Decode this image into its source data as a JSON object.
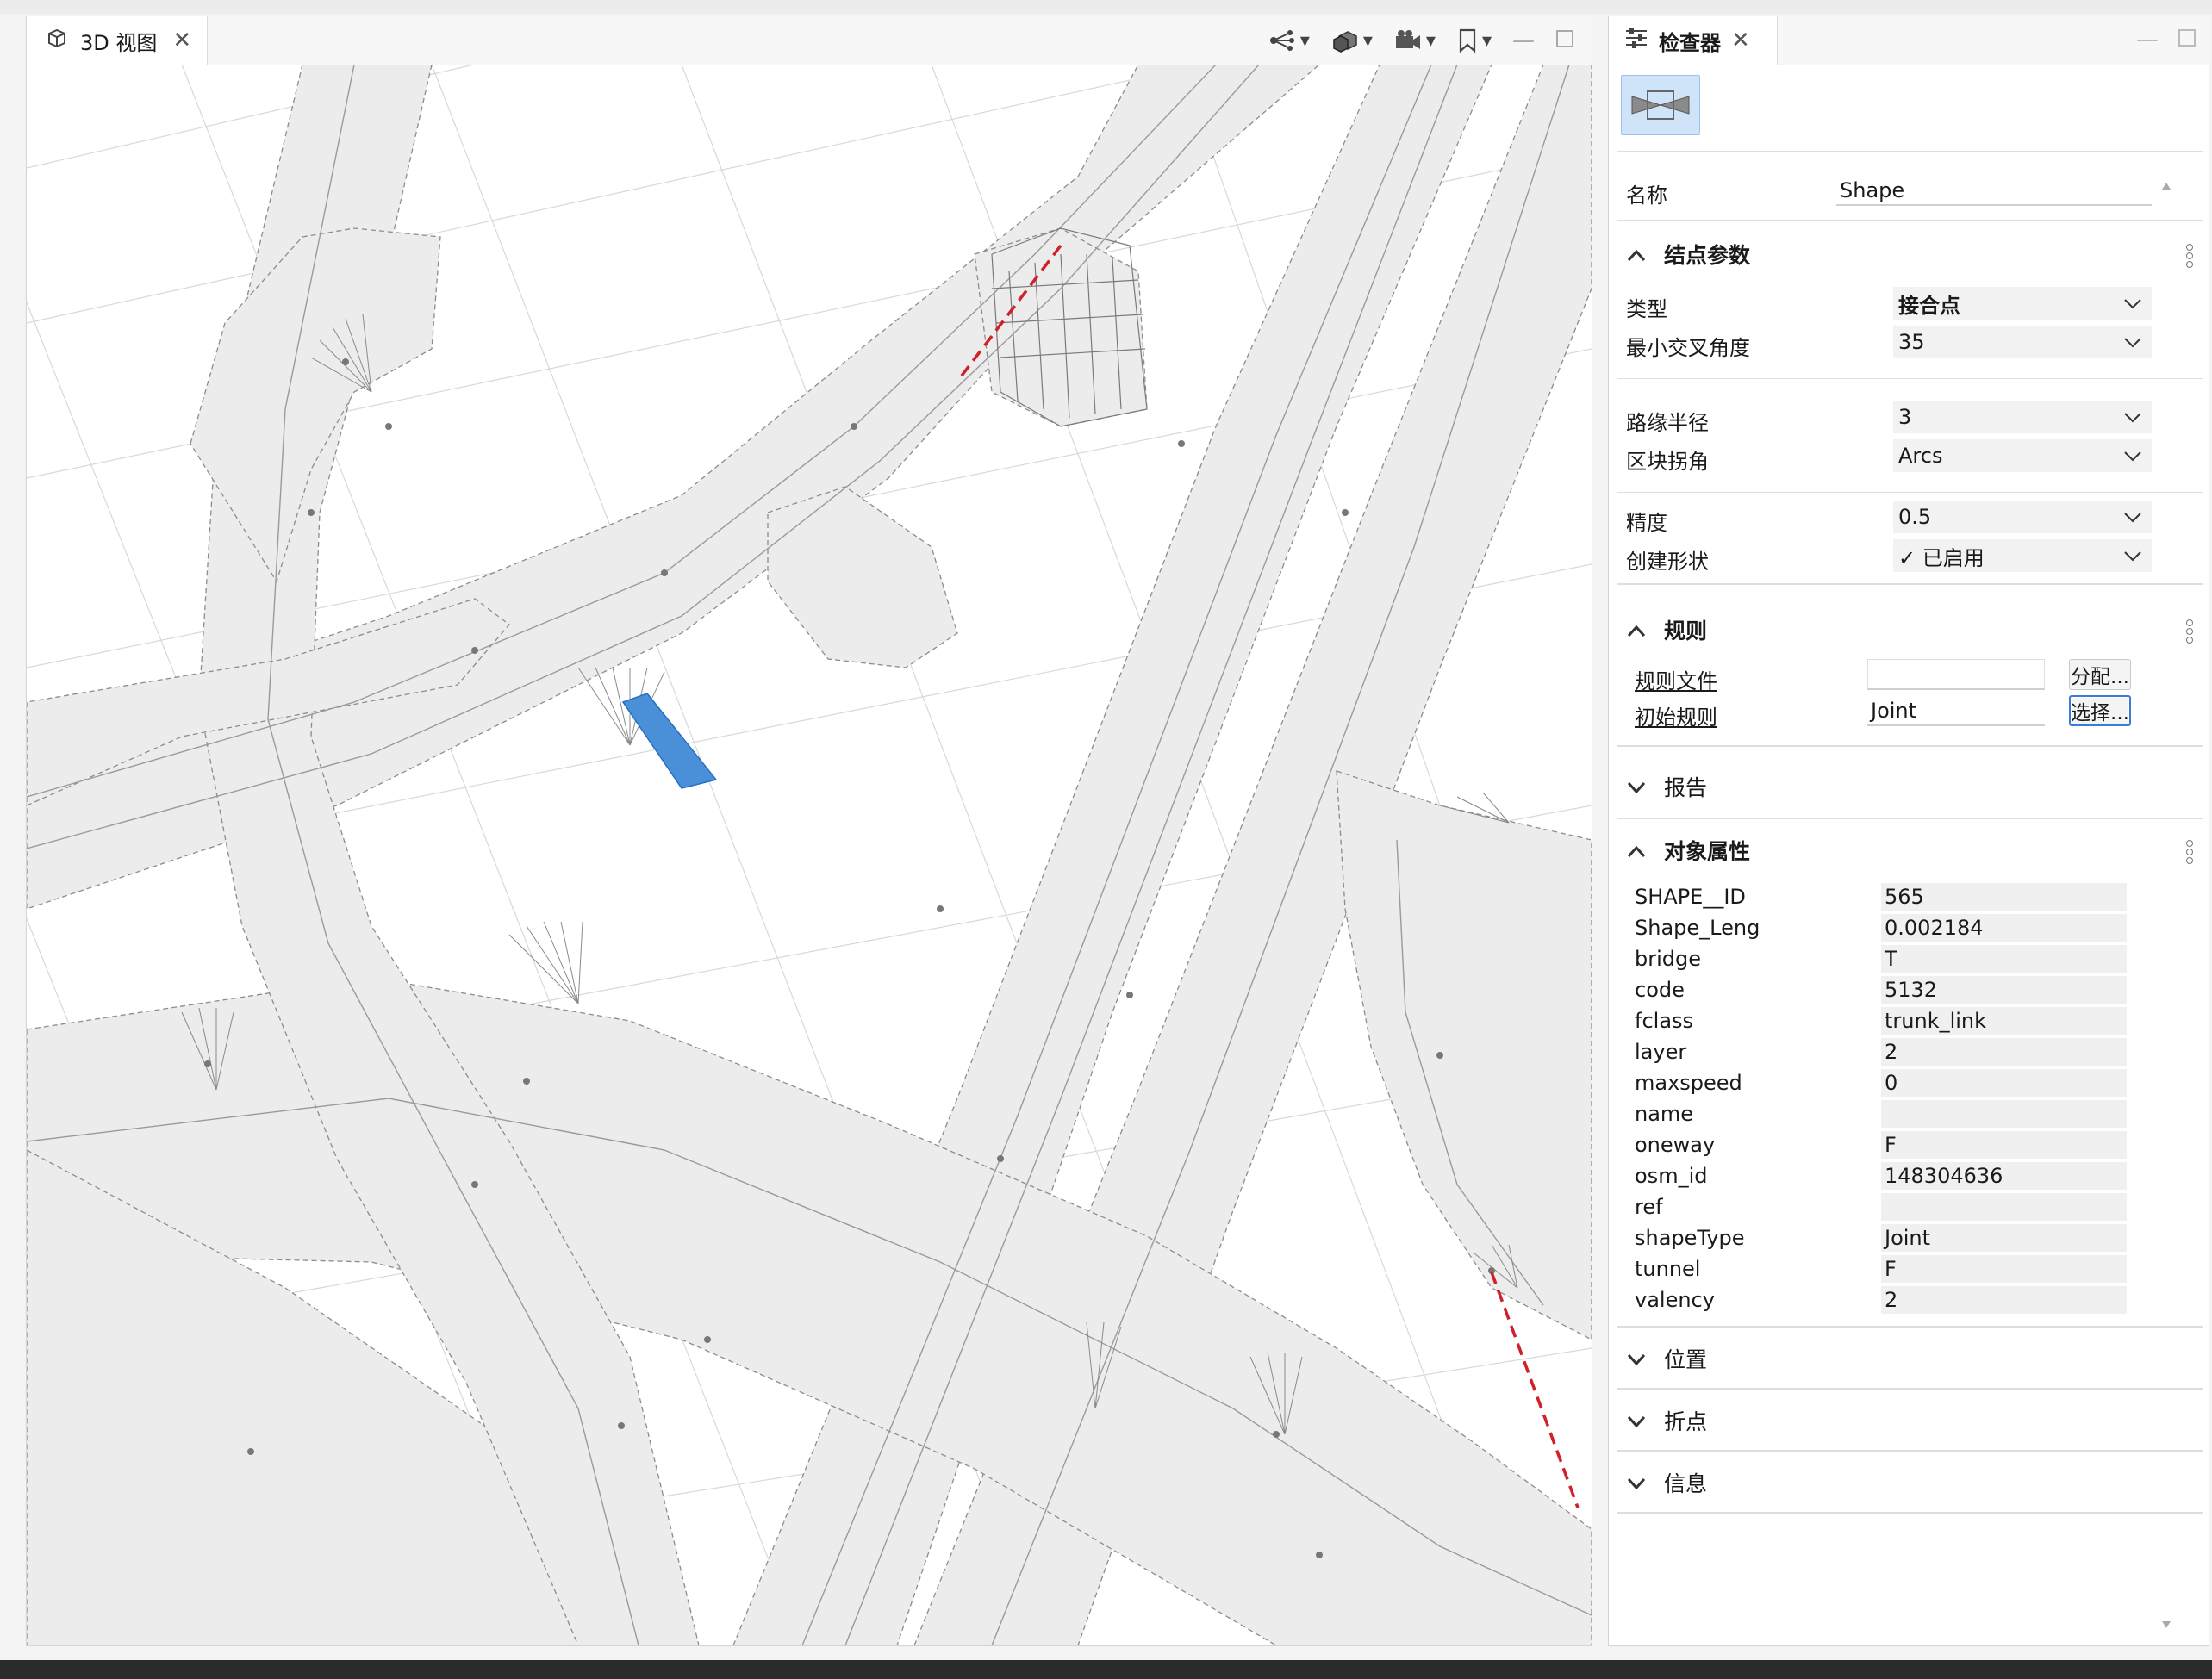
{
  "view_panel": {
    "tab_label": "3D 视图",
    "tab_icon": "cube-icon",
    "toolbar_icons": [
      "navigation-icon",
      "layers-cube-icon",
      "camera-icon",
      "bookmark-icon"
    ]
  },
  "inspector": {
    "tab_label": "检查器",
    "tab_icon": "sliders-icon",
    "name_label": "名称",
    "name_value": "Shape",
    "sections": {
      "node_params": {
        "title": "结点参数",
        "type_label": "类型",
        "type_value": "接合点",
        "min_angle_label": "最小交叉角度",
        "min_angle_value": "35",
        "curb_radius_label": "路缘半径",
        "curb_radius_value": "3",
        "block_corner_label": "区块拐角",
        "block_corner_value": "Arcs",
        "precision_label": "精度",
        "precision_value": "0.5",
        "create_shape_label": "创建形状",
        "create_shape_value": "✓ 已启用"
      },
      "rules": {
        "title": "规则",
        "rule_file_label": "规则文件",
        "rule_file_value": "",
        "assign_button": "分配...",
        "start_rule_label": "初始规则",
        "start_rule_value": "Joint",
        "select_button": "选择..."
      },
      "reports": {
        "title": "报告"
      },
      "object_attributes": {
        "title": "对象属性",
        "rows": [
          {
            "key": "SHAPE__ID",
            "value": "565"
          },
          {
            "key": "Shape_Leng",
            "value": "0.002184"
          },
          {
            "key": "bridge",
            "value": "T"
          },
          {
            "key": "code",
            "value": "5132"
          },
          {
            "key": "fclass",
            "value": "trunk_link"
          },
          {
            "key": "layer",
            "value": "2"
          },
          {
            "key": "maxspeed",
            "value": "0"
          },
          {
            "key": "name",
            "value": ""
          },
          {
            "key": "oneway",
            "value": "F"
          },
          {
            "key": "osm_id",
            "value": "148304636"
          },
          {
            "key": "ref",
            "value": ""
          },
          {
            "key": "shapeType",
            "value": "Joint"
          },
          {
            "key": "tunnel",
            "value": "F"
          },
          {
            "key": "valency",
            "value": "2"
          }
        ]
      },
      "position": {
        "title": "位置"
      },
      "vertices": {
        "title": "折点"
      },
      "info": {
        "title": "信息"
      }
    }
  },
  "colors": {
    "selection_blue": "#4a90d9",
    "highlight_red": "#d0202a",
    "road_fill": "#ececec",
    "accent": "#3b7ad8"
  }
}
